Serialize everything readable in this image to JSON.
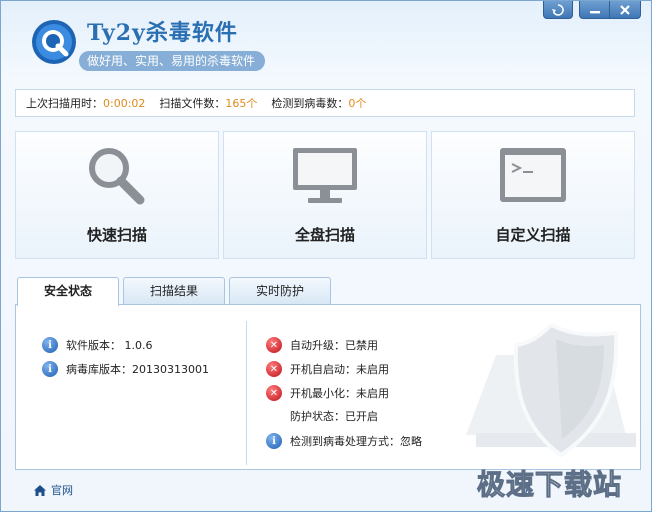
{
  "header": {
    "title": "Ty2y杀毒软件",
    "slogan": "做好用、实用、易用的杀毒软件"
  },
  "window_controls": [
    "skin-icon",
    "minimize-icon",
    "close-icon"
  ],
  "scan_info": {
    "last_scan_label": "上次扫描用时：",
    "last_scan_value": "0:00:02",
    "files_label": "扫描文件数：",
    "files_value": "165个",
    "virus_label": "检测到病毒数：",
    "virus_value": "0个"
  },
  "scan_options": [
    {
      "label": "快速扫描",
      "icon": "magnifier-icon"
    },
    {
      "label": "全盘扫描",
      "icon": "monitor-icon"
    },
    {
      "label": "自定义扫描",
      "icon": "terminal-icon"
    }
  ],
  "tabs": [
    {
      "label": "安全状态",
      "active": true
    },
    {
      "label": "扫描结果",
      "active": false
    },
    {
      "label": "实时防护",
      "active": false
    }
  ],
  "status_left": [
    {
      "icon": "info-icon",
      "text": "软件版本：  1.0.6"
    },
    {
      "icon": "info-icon",
      "text": "病毒库版本：20130313001"
    }
  ],
  "status_right": [
    {
      "icon": "error-icon",
      "text": "自动升级：已禁用"
    },
    {
      "icon": "error-icon",
      "text": "开机自启动：未启用"
    },
    {
      "icon": "error-icon",
      "text": "开机最小化：未启用"
    },
    {
      "icon": "none",
      "text": "防护状态：已开启"
    },
    {
      "icon": "info-icon",
      "text": "检测到病毒处理方式：忽略"
    }
  ],
  "footer": {
    "home_label": "官网",
    "right_partial": "级"
  },
  "watermark": "极速下载站",
  "colors": {
    "accent": "#2b6fb3",
    "value_orange": "#e08a1e",
    "error_red": "#c0141a",
    "info_blue": "#1f5fb0"
  }
}
